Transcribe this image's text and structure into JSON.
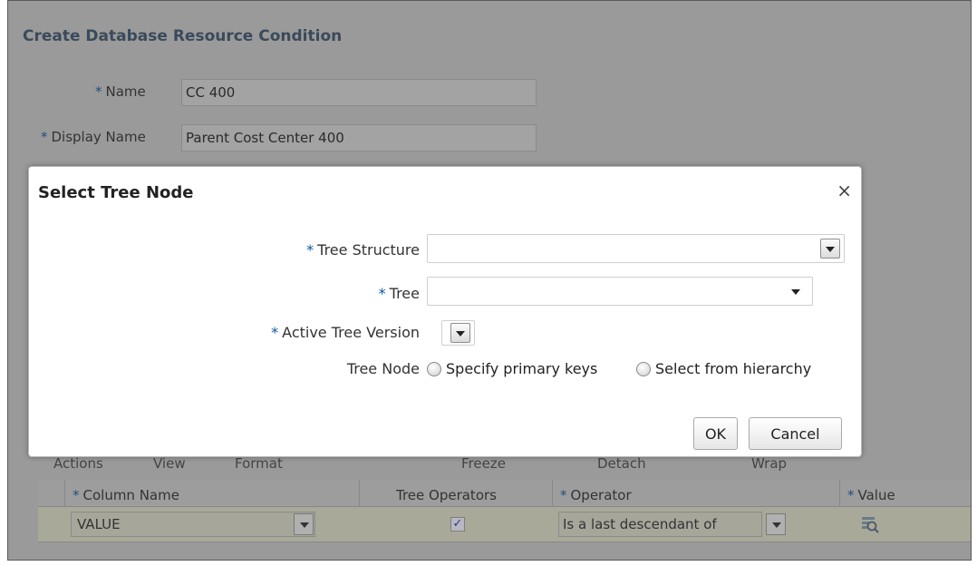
{
  "background": {
    "title": "Create Database Resource Condition",
    "required_marker": "*",
    "name_label": "Name",
    "name_value": "CC 400",
    "display_name_label": "Display Name",
    "display_name_value": "Parent Cost Center 400",
    "toolbar": [
      "Actions",
      "View",
      "Format",
      "Freeze",
      "Detach",
      "Wrap"
    ],
    "table": {
      "headers": [
        "Column Name",
        "Tree Operators",
        "Operator",
        "Value"
      ],
      "row": {
        "column_name": "VALUE",
        "tree_operators_checked": true,
        "operator": "Is a last descendant of"
      }
    }
  },
  "dialog": {
    "title": "Select Tree Node",
    "close": "×",
    "required_marker": "*",
    "tree_structure_label": "Tree Structure",
    "tree_structure_value": "",
    "tree_label": "Tree",
    "tree_value": "",
    "active_tree_version_label": "Active Tree Version",
    "tree_node_label": "Tree Node",
    "radio_options": [
      "Specify primary keys",
      "Select from hierarchy"
    ],
    "ok_label": "OK",
    "cancel_label": "Cancel"
  },
  "icons": {
    "dropdown": "chevron-down-icon",
    "close": "close-icon",
    "value_search": "search-icon"
  }
}
